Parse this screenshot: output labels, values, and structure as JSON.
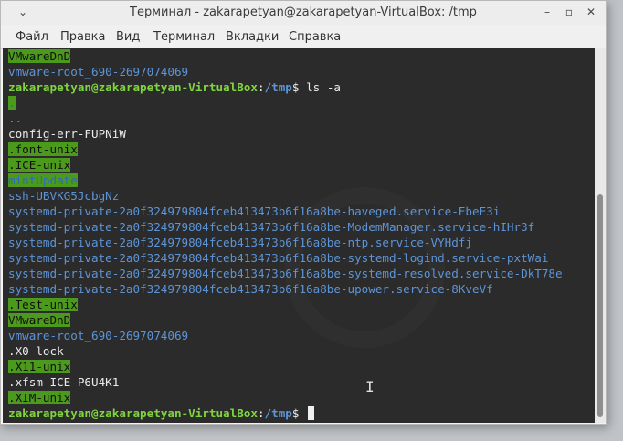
{
  "window": {
    "title": "Терминал - zakarapetyan@zakarapetyan-VirtualBox: /tmp",
    "collapse_glyph": "⌄",
    "minimize_glyph": "–",
    "maximize_glyph": "▫",
    "close_glyph": "✕"
  },
  "menu": [
    "Файл",
    "Правка",
    "Вид",
    "Терминал",
    "Вкладки",
    "Справка"
  ],
  "prompt": {
    "user": "zakarapetyan@zakarapetyan-VirtualBox",
    "sep": ":",
    "path": "/tmp",
    "symbol": "$"
  },
  "terminal": {
    "top": [
      "VMwareDnD",
      "vmware-root_690-2697074069"
    ],
    "command": "ls -a",
    "entries": [
      ".",
      "..",
      "config-err-FUPNiW",
      ".font-unix",
      ".ICE-unix",
      "mintUpdate",
      "ssh-UBVKG5JcbgNz",
      "systemd-private-2a0f324979804fceb413473b6f16a8be-haveged.service-EbeE3i",
      "systemd-private-2a0f324979804fceb413473b6f16a8be-ModemManager.service-hIHr3f",
      "systemd-private-2a0f324979804fceb413473b6f16a8be-ntp.service-VYHdfj",
      "systemd-private-2a0f324979804fceb413473b6f16a8be-systemd-logind.service-pxtWai",
      "systemd-private-2a0f324979804fceb413473b6f16a8be-systemd-resolved.service-DkT78e",
      "systemd-private-2a0f324979804fceb413473b6f16a8be-upower.service-8KveVf",
      ".Test-unix",
      "VMwareDnD",
      "vmware-root_690-2697074069",
      ".X0-lock",
      ".X11-unix",
      ".xfsm-ICE-P6U4K1",
      ".XIM-unix"
    ]
  },
  "colors": {
    "background": "#2b2b2b",
    "highlight": "#4b9a1b",
    "prompt_user": "#7fd53e",
    "directory": "#5d94d6"
  }
}
